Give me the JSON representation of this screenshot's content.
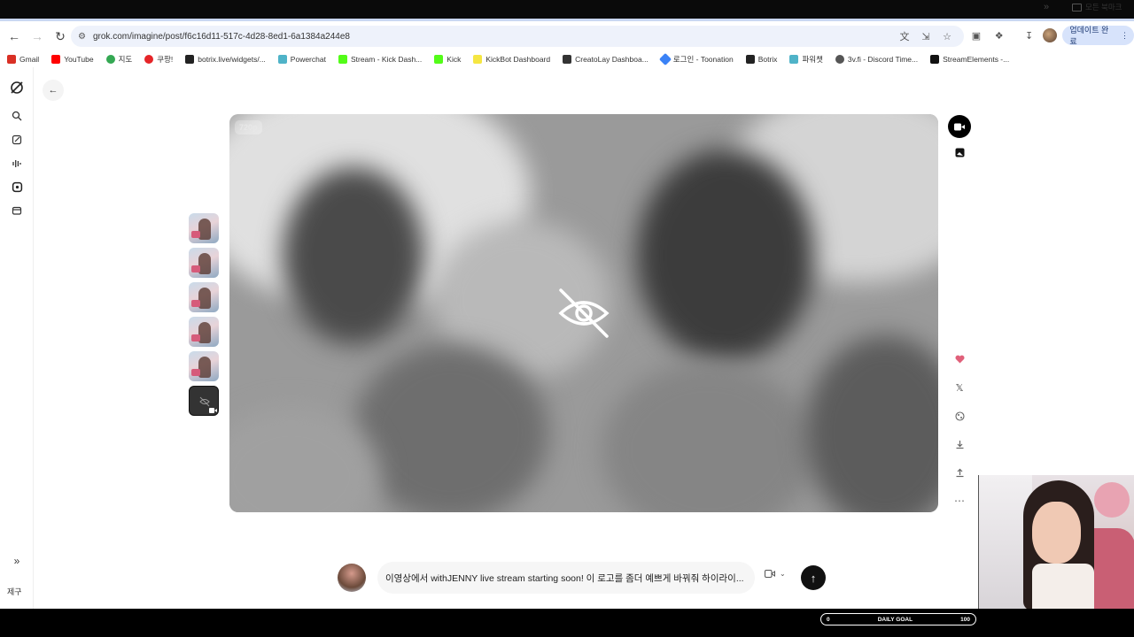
{
  "browser": {
    "url": "grok.com/imagine/post/f6c16d11-517c-4d28-8ed1-6a1384a244e8",
    "update_label": "업데이트 완료",
    "bookmarks": [
      {
        "label": "Gmail",
        "color": "#d93025"
      },
      {
        "label": "YouTube",
        "color": "#ff0000"
      },
      {
        "label": "지도",
        "color": "#34a853"
      },
      {
        "label": "쿠팡!",
        "color": "#e52528"
      },
      {
        "label": "botrix.live/widgets/...",
        "color": "#222222"
      },
      {
        "label": "Powerchat",
        "color": "#4fb3c8"
      },
      {
        "label": "Stream - Kick Dash...",
        "color": "#53fc18"
      },
      {
        "label": "Kick",
        "color": "#53fc18"
      },
      {
        "label": "KickBot Dashboard",
        "color": "#f5e642"
      },
      {
        "label": "CreatoLay Dashboa...",
        "color": "#333333"
      },
      {
        "label": "로그인 - Toonation",
        "color": "#3b82f6"
      },
      {
        "label": "Botrix",
        "color": "#222222"
      },
      {
        "label": "파워챗",
        "color": "#4fb3c8"
      },
      {
        "label": "3v.fi - Discord Time...",
        "color": "#555555"
      },
      {
        "label": "StreamElements -...",
        "color": "#111111"
      }
    ],
    "all_bookmarks_label": "모든 북마크"
  },
  "sidebar": {
    "icons": [
      "grok-logo-icon",
      "search-icon",
      "edit-icon",
      "voice-icon",
      "imagine-icon",
      "files-icon"
    ],
    "user_label": "제구"
  },
  "viewer": {
    "resolution_badge": "720p",
    "hidden_content_icon": "eye-off-icon"
  },
  "thumbnails": [
    {
      "active": false
    },
    {
      "active": false
    },
    {
      "active": false
    },
    {
      "active": false
    },
    {
      "active": false
    },
    {
      "active": true
    }
  ],
  "actions": [
    "video-icon",
    "image-icon",
    "heart-icon",
    "x-logo-icon",
    "remix-icon",
    "download-icon",
    "share-icon",
    "more-icon"
  ],
  "prompt": {
    "text": "이영상에서 withJENNY live stream starting soon! 이 로고를 좀더 예쁘게 바꿔줘 하이라이..."
  },
  "overlay": {
    "goal_left": "0",
    "goal_label": "DAILY GOAL",
    "goal_right": "100"
  },
  "colors": {
    "accent_blue": "#d7e3fb",
    "like_pink": "#e0607a"
  }
}
